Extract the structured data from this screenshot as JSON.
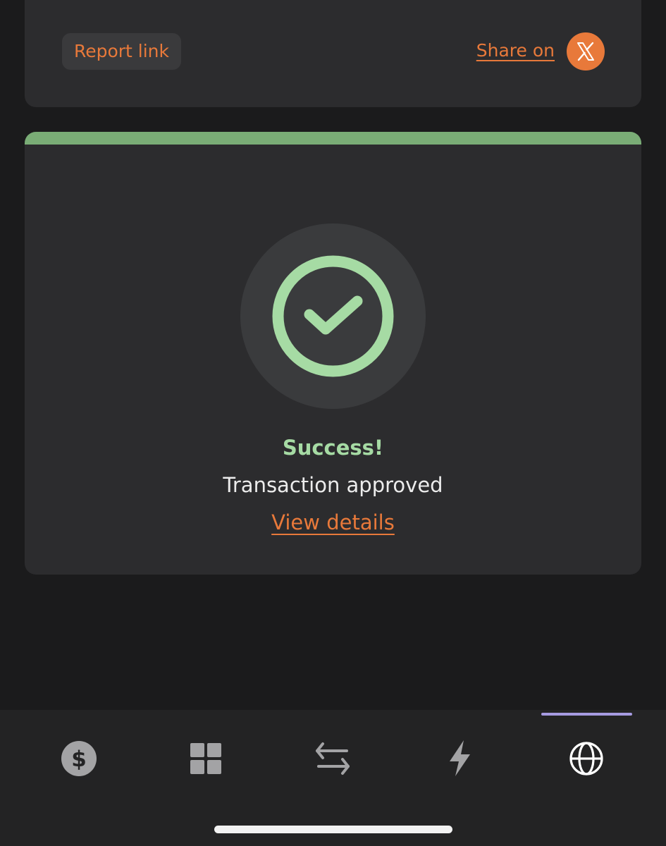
{
  "top_card": {
    "report_label": "Report link",
    "share_label": "Share on",
    "share_icon": "x-logo-icon"
  },
  "result": {
    "status_icon": "check-circle-icon",
    "title": "Success!",
    "message": "Transaction approved",
    "details_link": "View details"
  },
  "nav": {
    "items": [
      {
        "icon": "dollar-icon",
        "active": false
      },
      {
        "icon": "grid-icon",
        "active": false
      },
      {
        "icon": "swap-arrows-icon",
        "active": false
      },
      {
        "icon": "lightning-icon",
        "active": false
      },
      {
        "icon": "globe-icon",
        "active": true
      }
    ]
  },
  "colors": {
    "accent": "#e8793a",
    "success": "#a6dba4",
    "success_bar": "#7aad76",
    "active_tab": "#a79be2",
    "background": "#1b1b1c",
    "card": "#2c2c2e"
  }
}
